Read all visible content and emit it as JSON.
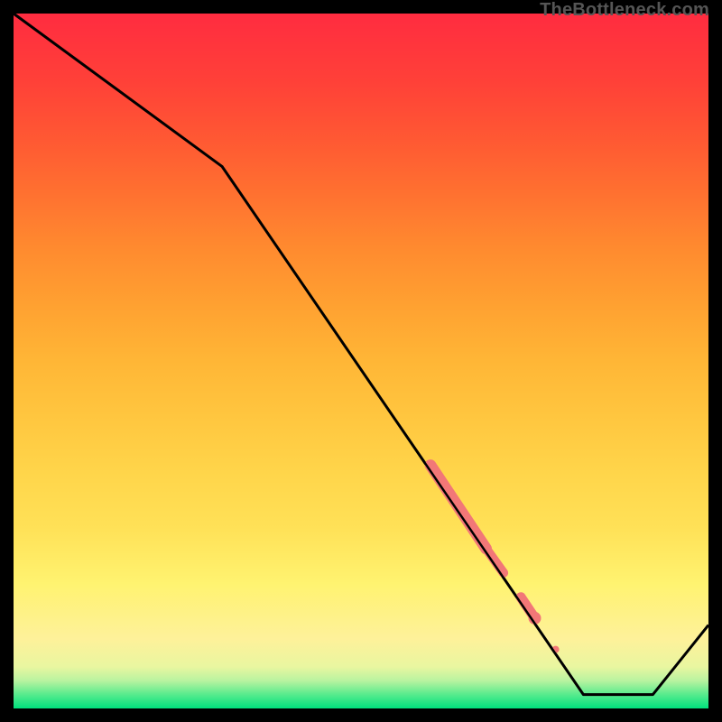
{
  "watermark": "TheBottleneck.com",
  "chart_data": {
    "type": "line",
    "title": "",
    "xlabel": "",
    "ylabel": "",
    "xlim": [
      0,
      100
    ],
    "ylim": [
      0,
      100
    ],
    "grid": false,
    "legend": false,
    "series": [
      {
        "name": "bottleneck-curve",
        "x": [
          0,
          30,
          82,
          92,
          100
        ],
        "values": [
          100,
          78,
          2,
          2,
          12
        ]
      }
    ],
    "markers": {
      "name": "highlight-segment",
      "comment": "thick salmon overlay along part of the descending slope",
      "color": "#f27777",
      "points": [
        {
          "x": 60,
          "y": 35,
          "w": 8
        },
        {
          "x": 68,
          "y": 23,
          "w": 8
        },
        {
          "x": 70.5,
          "y": 19.5,
          "w": 5
        },
        {
          "x": 73,
          "y": 16,
          "w": 7
        },
        {
          "x": 75,
          "y": 13,
          "w": 7
        },
        {
          "x": 78,
          "y": 8.5,
          "w": 4
        }
      ]
    }
  }
}
